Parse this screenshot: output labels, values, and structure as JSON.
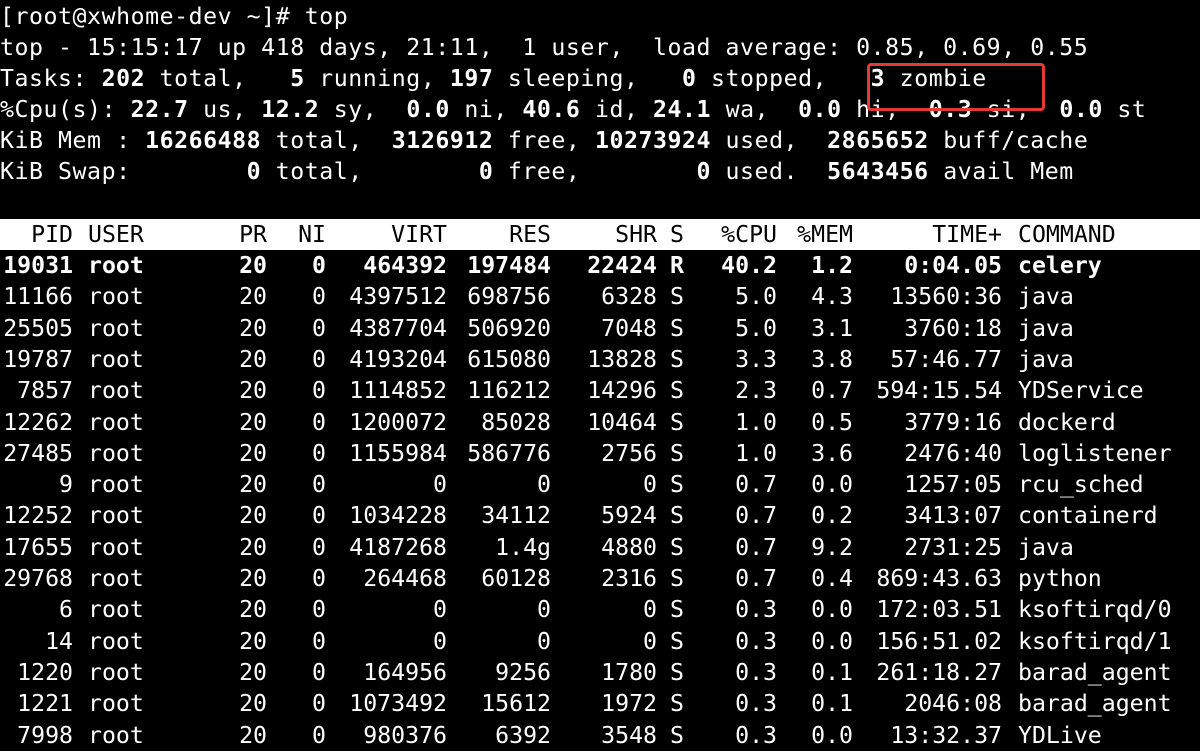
{
  "prompt": {
    "text": "[root@xwhome-dev ~]# top"
  },
  "summary": {
    "line1": "top - 15:15:17 up 418 days, 21:11,  1 user,  load average: 0.85, 0.69, 0.55",
    "tasks": [
      {
        "text": "Tasks: ",
        "bold": false
      },
      {
        "text": "202",
        "bold": true
      },
      {
        "text": " total,   ",
        "bold": false
      },
      {
        "text": "5",
        "bold": true
      },
      {
        "text": " running, ",
        "bold": false
      },
      {
        "text": "197",
        "bold": true
      },
      {
        "text": " sleeping,   ",
        "bold": false
      },
      {
        "text": "0",
        "bold": true
      },
      {
        "text": " stopped,   ",
        "bold": false
      },
      {
        "text": "3",
        "bold": true
      },
      {
        "text": " zombie",
        "bold": false
      }
    ],
    "cpu": [
      {
        "text": "%Cpu(s): ",
        "bold": false
      },
      {
        "text": "22.7",
        "bold": true
      },
      {
        "text": " us, ",
        "bold": false
      },
      {
        "text": "12.2",
        "bold": true
      },
      {
        "text": " sy,  ",
        "bold": false
      },
      {
        "text": "0.0",
        "bold": true
      },
      {
        "text": " ni, ",
        "bold": false
      },
      {
        "text": "40.6",
        "bold": true
      },
      {
        "text": " id, ",
        "bold": false
      },
      {
        "text": "24.1",
        "bold": true
      },
      {
        "text": " wa,  ",
        "bold": false
      },
      {
        "text": "0.0",
        "bold": true
      },
      {
        "text": " hi,  ",
        "bold": false
      },
      {
        "text": "0.3",
        "bold": true
      },
      {
        "text": " si,  ",
        "bold": false
      },
      {
        "text": "0.0",
        "bold": true
      },
      {
        "text": " st",
        "bold": false
      }
    ],
    "mem": [
      {
        "text": "KiB Mem : ",
        "bold": false
      },
      {
        "text": "16266488",
        "bold": true
      },
      {
        "text": " total,  ",
        "bold": false
      },
      {
        "text": "3126912",
        "bold": true
      },
      {
        "text": " free, ",
        "bold": false
      },
      {
        "text": "10273924",
        "bold": true
      },
      {
        "text": " used,  ",
        "bold": false
      },
      {
        "text": "2865652",
        "bold": true
      },
      {
        "text": " buff/cache",
        "bold": false
      }
    ],
    "swap": [
      {
        "text": "KiB Swap:        ",
        "bold": false
      },
      {
        "text": "0",
        "bold": true
      },
      {
        "text": " total,        ",
        "bold": false
      },
      {
        "text": "0",
        "bold": true
      },
      {
        "text": " free,        ",
        "bold": false
      },
      {
        "text": "0",
        "bold": true
      },
      {
        "text": " used.  ",
        "bold": false
      },
      {
        "text": "5643456",
        "bold": true
      },
      {
        "text": " avail Mem",
        "bold": false
      }
    ]
  },
  "annotation": {
    "highlight_color": "#e53935"
  },
  "table": {
    "columns": [
      "PID",
      "USER",
      "PR",
      "NI",
      "VIRT",
      "RES",
      "SHR",
      "S",
      "%CPU",
      "%MEM",
      "TIME+",
      "COMMAND"
    ],
    "rows": [
      {
        "pid": "19031",
        "user": "root",
        "pr": "20",
        "ni": "0",
        "virt": "464392",
        "res": "197484",
        "shr": "22424",
        "s": "R",
        "cpu": "40.2",
        "mem": "1.2",
        "time": "0:04.05",
        "command": "celery",
        "bold": true
      },
      {
        "pid": "11166",
        "user": "root",
        "pr": "20",
        "ni": "0",
        "virt": "4397512",
        "res": "698756",
        "shr": "6328",
        "s": "S",
        "cpu": "5.0",
        "mem": "4.3",
        "time": "13560:36",
        "command": "java"
      },
      {
        "pid": "25505",
        "user": "root",
        "pr": "20",
        "ni": "0",
        "virt": "4387704",
        "res": "506920",
        "shr": "7048",
        "s": "S",
        "cpu": "5.0",
        "mem": "3.1",
        "time": "3760:18",
        "command": "java"
      },
      {
        "pid": "19787",
        "user": "root",
        "pr": "20",
        "ni": "0",
        "virt": "4193204",
        "res": "615080",
        "shr": "13828",
        "s": "S",
        "cpu": "3.3",
        "mem": "3.8",
        "time": "57:46.77",
        "command": "java"
      },
      {
        "pid": "7857",
        "user": "root",
        "pr": "20",
        "ni": "0",
        "virt": "1114852",
        "res": "116212",
        "shr": "14296",
        "s": "S",
        "cpu": "2.3",
        "mem": "0.7",
        "time": "594:15.54",
        "command": "YDService"
      },
      {
        "pid": "12262",
        "user": "root",
        "pr": "20",
        "ni": "0",
        "virt": "1200072",
        "res": "85028",
        "shr": "10464",
        "s": "S",
        "cpu": "1.0",
        "mem": "0.5",
        "time": "3779:16",
        "command": "dockerd"
      },
      {
        "pid": "27485",
        "user": "root",
        "pr": "20",
        "ni": "0",
        "virt": "1155984",
        "res": "586776",
        "shr": "2756",
        "s": "S",
        "cpu": "1.0",
        "mem": "3.6",
        "time": "2476:40",
        "command": "loglistener"
      },
      {
        "pid": "9",
        "user": "root",
        "pr": "20",
        "ni": "0",
        "virt": "0",
        "res": "0",
        "shr": "0",
        "s": "S",
        "cpu": "0.7",
        "mem": "0.0",
        "time": "1257:05",
        "command": "rcu_sched"
      },
      {
        "pid": "12252",
        "user": "root",
        "pr": "20",
        "ni": "0",
        "virt": "1034228",
        "res": "34112",
        "shr": "5924",
        "s": "S",
        "cpu": "0.7",
        "mem": "0.2",
        "time": "3413:07",
        "command": "containerd"
      },
      {
        "pid": "17655",
        "user": "root",
        "pr": "20",
        "ni": "0",
        "virt": "4187268",
        "res": "1.4g",
        "shr": "4880",
        "s": "S",
        "cpu": "0.7",
        "mem": "9.2",
        "time": "2731:25",
        "command": "java"
      },
      {
        "pid": "29768",
        "user": "root",
        "pr": "20",
        "ni": "0",
        "virt": "264468",
        "res": "60128",
        "shr": "2316",
        "s": "S",
        "cpu": "0.7",
        "mem": "0.4",
        "time": "869:43.63",
        "command": "python"
      },
      {
        "pid": "6",
        "user": "root",
        "pr": "20",
        "ni": "0",
        "virt": "0",
        "res": "0",
        "shr": "0",
        "s": "S",
        "cpu": "0.3",
        "mem": "0.0",
        "time": "172:03.51",
        "command": "ksoftirqd/0"
      },
      {
        "pid": "14",
        "user": "root",
        "pr": "20",
        "ni": "0",
        "virt": "0",
        "res": "0",
        "shr": "0",
        "s": "S",
        "cpu": "0.3",
        "mem": "0.0",
        "time": "156:51.02",
        "command": "ksoftirqd/1"
      },
      {
        "pid": "1220",
        "user": "root",
        "pr": "20",
        "ni": "0",
        "virt": "164956",
        "res": "9256",
        "shr": "1780",
        "s": "S",
        "cpu": "0.3",
        "mem": "0.1",
        "time": "261:18.27",
        "command": "barad_agent"
      },
      {
        "pid": "1221",
        "user": "root",
        "pr": "20",
        "ni": "0",
        "virt": "1073492",
        "res": "15612",
        "shr": "1972",
        "s": "S",
        "cpu": "0.3",
        "mem": "0.1",
        "time": "2046:08",
        "command": "barad_agent"
      },
      {
        "pid": "7998",
        "user": "root",
        "pr": "20",
        "ni": "0",
        "virt": "980376",
        "res": "6392",
        "shr": "3548",
        "s": "S",
        "cpu": "0.3",
        "mem": "0.0",
        "time": "13:32.37",
        "command": "YDLive"
      }
    ]
  }
}
